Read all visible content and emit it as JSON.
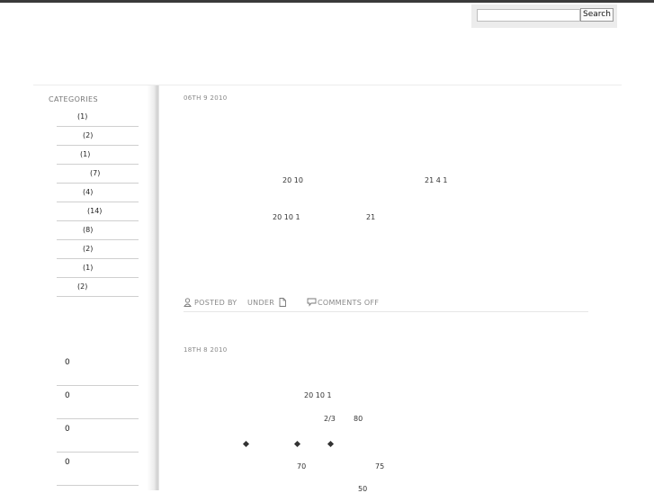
{
  "search": {
    "placeholder": "",
    "button_label": "Search"
  },
  "sidebar": {
    "categories_heading": "CATEGORIES",
    "categories": [
      {
        "count": "(1)"
      },
      {
        "count": "(2)"
      },
      {
        "count": "(1)"
      },
      {
        "count": "(7)"
      },
      {
        "count": "(4)"
      },
      {
        "count": "(14)"
      },
      {
        "count": "(8)"
      },
      {
        "count": "(2)"
      },
      {
        "count": "(1)"
      },
      {
        "count": "(2)"
      }
    ],
    "comment_counts": [
      "0",
      "0",
      "0",
      "0"
    ]
  },
  "posts": [
    {
      "date": "06TH 9  2010",
      "lines": [
        "20 10",
        "21 4 1",
        "20 10 1",
        "21"
      ],
      "meta": {
        "posted_by": "POSTED BY",
        "under": "UNDER",
        "comments": "COMMENTS OFF"
      }
    },
    {
      "date": "18TH 8  2010",
      "lines": [
        "20 10 1",
        "2/3",
        "80",
        "70",
        "75",
        "50"
      ]
    }
  ]
}
